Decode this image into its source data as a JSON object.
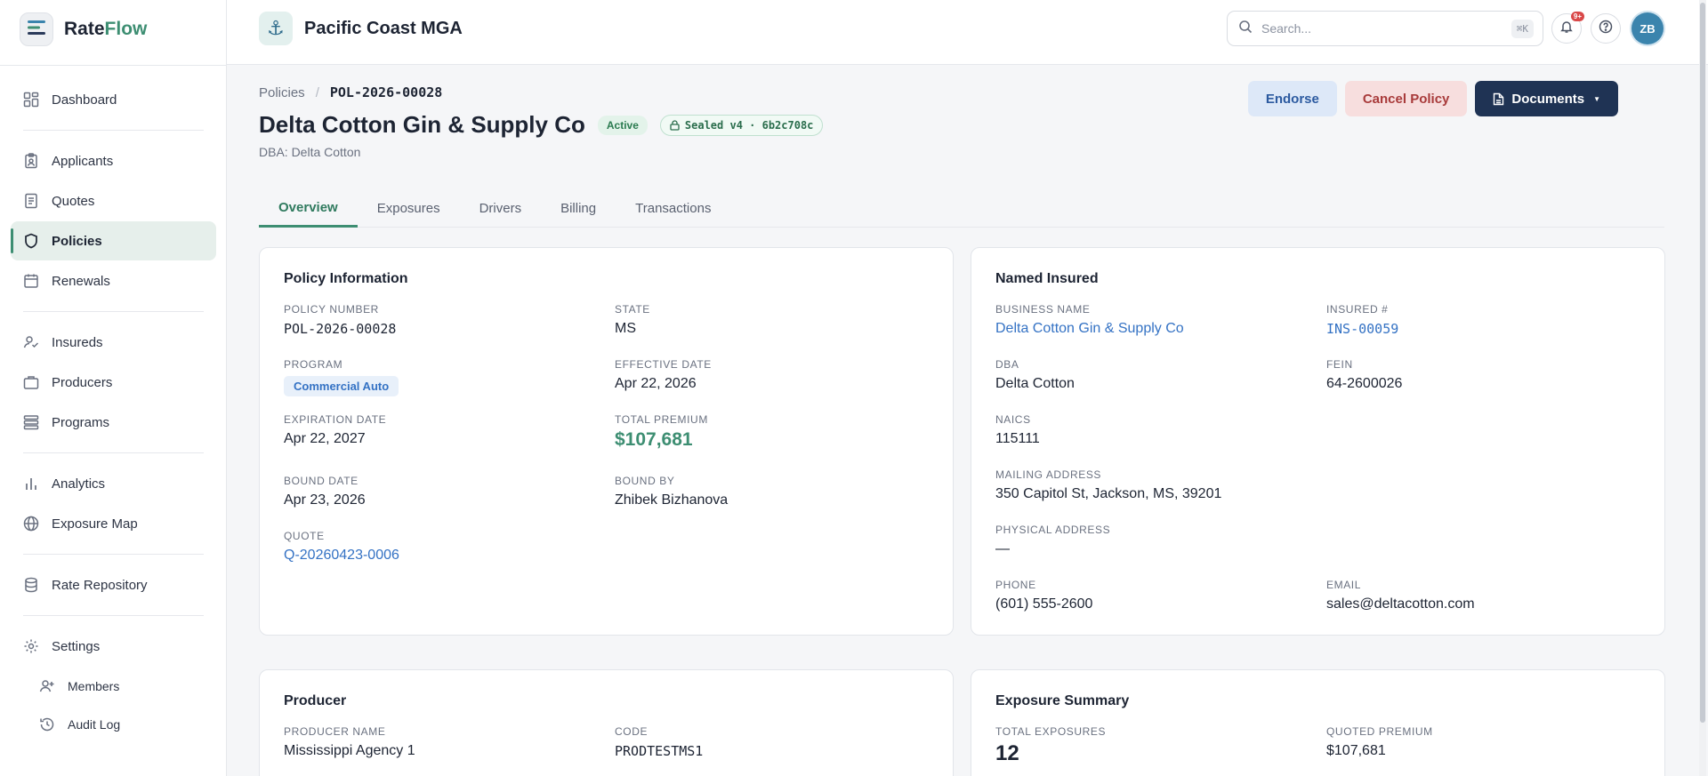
{
  "brand": {
    "name_prefix": "Rate",
    "name_accent": "Flow"
  },
  "sidebar": {
    "items": [
      {
        "id": "dashboard",
        "label": "Dashboard",
        "icon": "grid-icon"
      },
      {
        "id": "applicants",
        "label": "Applicants",
        "icon": "clipboard-user-icon"
      },
      {
        "id": "quotes",
        "label": "Quotes",
        "icon": "document-icon"
      },
      {
        "id": "policies",
        "label": "Policies",
        "icon": "shield-icon",
        "active": true
      },
      {
        "id": "renewals",
        "label": "Renewals",
        "icon": "calendar-icon"
      },
      {
        "id": "insureds",
        "label": "Insureds",
        "icon": "user-check-icon"
      },
      {
        "id": "producers",
        "label": "Producers",
        "icon": "briefcase-icon"
      },
      {
        "id": "programs",
        "label": "Programs",
        "icon": "layers-icon"
      },
      {
        "id": "analytics",
        "label": "Analytics",
        "icon": "bar-chart-icon"
      },
      {
        "id": "exposure-map",
        "label": "Exposure Map",
        "icon": "globe-icon"
      },
      {
        "id": "rate-repository",
        "label": "Rate Repository",
        "icon": "database-icon"
      },
      {
        "id": "settings",
        "label": "Settings",
        "icon": "gear-icon"
      }
    ],
    "sub_items": [
      {
        "id": "members",
        "label": "Members",
        "icon": "user-plus-icon"
      },
      {
        "id": "audit-log",
        "label": "Audit Log",
        "icon": "history-icon"
      }
    ]
  },
  "header": {
    "org_name": "Pacific Coast MGA",
    "org_icon": "anchor-icon",
    "search_placeholder": "Search...",
    "search_shortcut": "⌘K",
    "notification_count": "9+",
    "avatar_initials": "ZB"
  },
  "page": {
    "breadcrumb_parent": "Policies",
    "breadcrumb_current": "POL-2026-00028",
    "title": "Delta Cotton Gin & Supply Co",
    "status": "Active",
    "sealed": "Sealed v4 · 6b2c708c",
    "dba_line": "DBA: Delta Cotton",
    "actions": {
      "endorse": "Endorse",
      "cancel": "Cancel Policy",
      "documents": "Documents"
    },
    "tabs": [
      "Overview",
      "Exposures",
      "Drivers",
      "Billing",
      "Transactions"
    ]
  },
  "policy_info": {
    "title": "Policy Information",
    "policy_number_label": "Policy Number",
    "policy_number": "POL-2026-00028",
    "state_label": "State",
    "state": "MS",
    "program_label": "Program",
    "program": "Commercial Auto",
    "effective_label": "Effective Date",
    "effective": "Apr 22, 2026",
    "expiration_label": "Expiration Date",
    "expiration": "Apr 22, 2027",
    "premium_label": "Total Premium",
    "premium": "$107,681",
    "bound_date_label": "Bound Date",
    "bound_date": "Apr 23, 2026",
    "bound_by_label": "Bound By",
    "bound_by": "Zhibek Bizhanova",
    "quote_label": "Quote",
    "quote": "Q-20260423-0006"
  },
  "named_insured": {
    "title": "Named Insured",
    "business_label": "Business Name",
    "business": "Delta Cotton Gin & Supply Co",
    "insured_no_label": "Insured #",
    "insured_no": "INS-00059",
    "dba_label": "DBA",
    "dba": "Delta Cotton",
    "fein_label": "FEIN",
    "fein": "64-2600026",
    "naics_label": "NAICS",
    "naics": "115111",
    "mailing_label": "Mailing Address",
    "mailing": "350 Capitol St, Jackson, MS, 39201",
    "physical_label": "Physical Address",
    "physical": "—",
    "phone_label": "Phone",
    "phone": "(601) 555-2600",
    "email_label": "Email",
    "email": "sales@deltacotton.com"
  },
  "producer": {
    "title": "Producer",
    "name_label": "Producer Name",
    "name": "Mississippi Agency 1",
    "code_label": "Code",
    "code": "PRODTESTMS1"
  },
  "exposure_summary": {
    "title": "Exposure Summary",
    "total_label": "Total Exposures",
    "total": "12",
    "quoted_label": "Quoted Premium",
    "quoted": "$107,681"
  }
}
